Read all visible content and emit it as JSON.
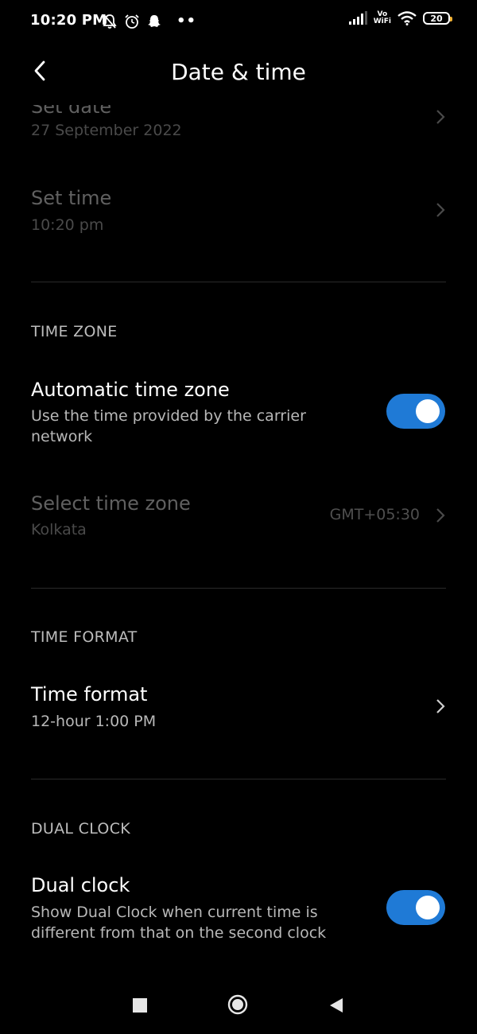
{
  "status_bar": {
    "time": "10:20 PM",
    "left_icons": [
      "silent-bell-icon",
      "alarm-icon",
      "snapchat-icon"
    ],
    "more": "••",
    "vowifi_top": "Vo",
    "vowifi_bottom": "WiFi",
    "battery": "20"
  },
  "header": {
    "title": "Date & time",
    "back_icon": "back-arrow-icon"
  },
  "rows": {
    "set_date": {
      "title": "Set date",
      "subtitle": "27 September 2022"
    },
    "set_time": {
      "title": "Set time",
      "subtitle": "10:20 pm"
    },
    "automatic_time_zone": {
      "title": "Automatic time zone",
      "subtitle_line1": "Use the time provided by the carrier",
      "subtitle_line2": "network",
      "enabled": true
    },
    "select_time_zone": {
      "title": "Select time zone",
      "subtitle": "Kolkata",
      "value": "GMT+05:30"
    },
    "time_format": {
      "title": "Time format",
      "subtitle": "12-hour 1:00 PM"
    },
    "dual_clock": {
      "title": "Dual clock",
      "subtitle_line1": "Show Dual Clock when current time is",
      "subtitle_line2": "different from that on the second clock",
      "enabled": true
    }
  },
  "sections": {
    "time_zone": "TIME ZONE",
    "time_format": "TIME FORMAT",
    "dual_clock": "DUAL CLOCK"
  },
  "colors": {
    "accent": "#1f7ad6",
    "background": "#000000"
  },
  "nav_bar": {
    "icons": [
      "recents-square-icon",
      "home-circle-icon",
      "back-triangle-icon"
    ]
  }
}
